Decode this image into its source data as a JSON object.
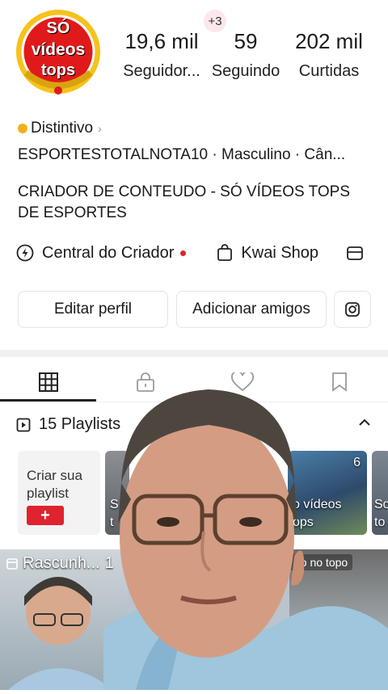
{
  "avatar": {
    "line1": "SÓ",
    "line2": "vídeos",
    "line3": "tops"
  },
  "notification_badge": "+3",
  "stats": [
    {
      "value": "19,6 mil",
      "label": "Seguidor..."
    },
    {
      "value": "59",
      "label": "Seguindo"
    },
    {
      "value": "202 mil",
      "label": "Curtidas"
    }
  ],
  "badge": {
    "label": "Distintivo",
    "chevron": "›"
  },
  "info_line": "ESPORTESTOTALNOTA10 · Masculino · Cân...",
  "bio": "CRIADOR DE CONTEUDO - SÓ VÍDEOS TOPS DE ESPORTES",
  "creator_row": {
    "central": "Central do Criador",
    "shop": "Kwai Shop"
  },
  "buttons": {
    "edit": "Editar perfil",
    "add_friends": "Adicionar amigos"
  },
  "playlists": {
    "title": "15 Playlists",
    "create_label_1": "Criar sua",
    "create_label_2": "playlist",
    "plus": "+",
    "thumb_count": "6",
    "thumb_caption_1": "o vídeos",
    "thumb_caption_2": "ops",
    "thumb2_text": "S",
    "thumb2_text_b": "t",
    "thumb4_text": "So",
    "thumb4_text_b": "to"
  },
  "grid": {
    "draft_label": "Rascunh...",
    "draft_count": "1",
    "topo_label": "no no topo"
  },
  "colors": {
    "accent_red": "#e0242f",
    "gold": "#f2b01e"
  }
}
